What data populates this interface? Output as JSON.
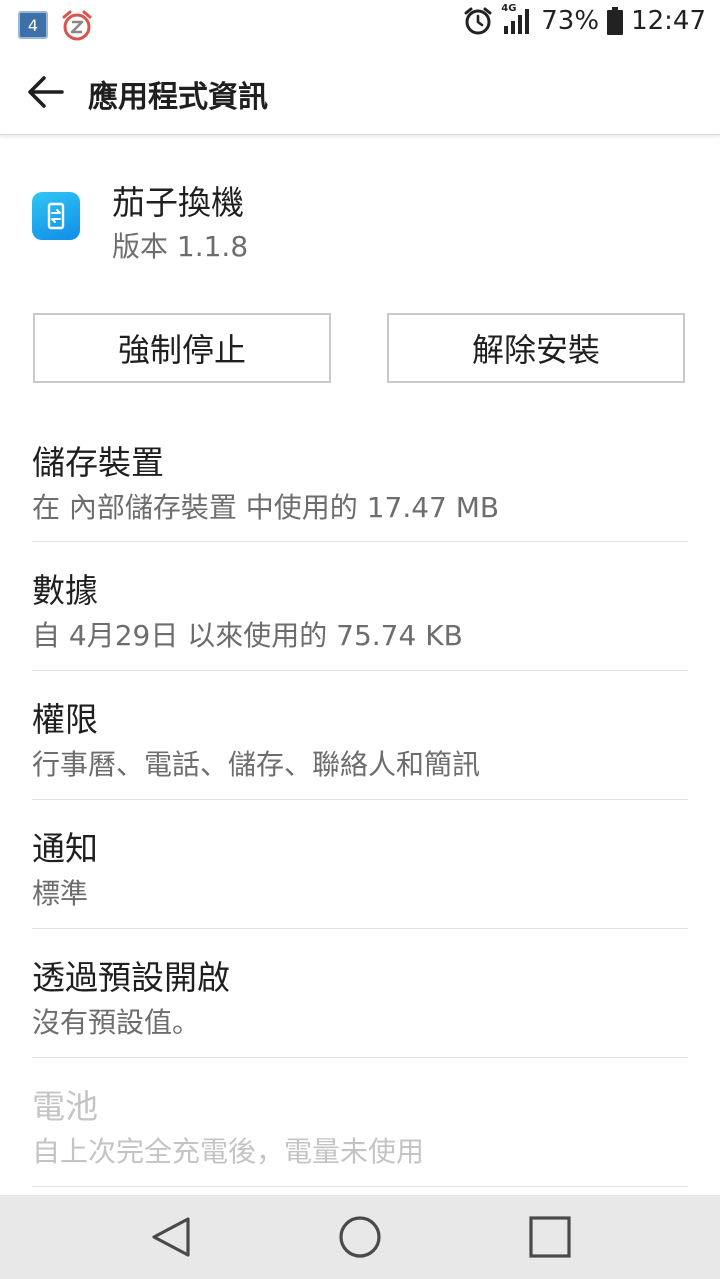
{
  "status_bar": {
    "notification_count": "4",
    "network_type": "4G",
    "battery_percent": "73%",
    "time": "12:47",
    "icons": [
      "notification-badge-icon",
      "snooze-alarm-icon",
      "alarm-clock-icon",
      "signal-icon",
      "battery-icon"
    ]
  },
  "app_bar": {
    "title": "應用程式資訊"
  },
  "app": {
    "name": "茄子換機",
    "version": "版本 1.1.8",
    "icon_color": "#1a9cf0"
  },
  "actions": {
    "force_stop": "強制停止",
    "uninstall": "解除安裝"
  },
  "sections": [
    {
      "title": "儲存裝置",
      "subtitle": "在 內部儲存裝置 中使用的 17.47 MB",
      "enabled": true
    },
    {
      "title": "數據",
      "subtitle": "自 4月29日 以來使用的 75.74 KB",
      "enabled": true
    },
    {
      "title": "權限",
      "subtitle": "行事曆、電話、儲存、聯絡人和簡訊",
      "enabled": true
    },
    {
      "title": "通知",
      "subtitle": "標準",
      "enabled": true
    },
    {
      "title": "透過預設開啟",
      "subtitle": "沒有預設值。",
      "enabled": true
    },
    {
      "title": "電池",
      "subtitle": "自上次完全充電後，電量未使用",
      "enabled": false
    }
  ],
  "nav_bar": {
    "icons": [
      "nav-back-icon",
      "nav-home-icon",
      "nav-recent-icon"
    ]
  }
}
